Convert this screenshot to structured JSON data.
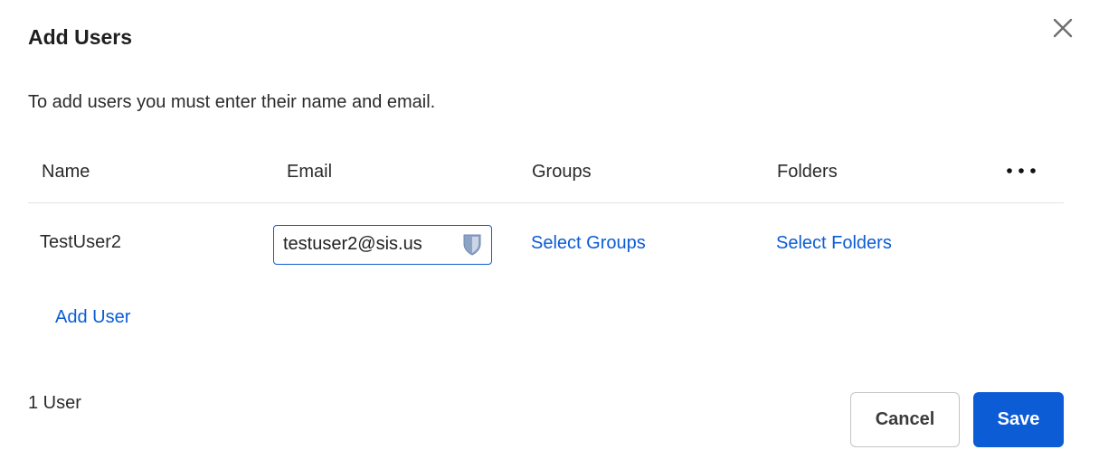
{
  "dialog": {
    "title": "Add Users",
    "close_icon": "close-icon",
    "subtitle": "To add users you must enter their name and email."
  },
  "table": {
    "columns": [
      "Name",
      "Email",
      "Groups",
      "Folders"
    ],
    "more_icon": "more-horizontal-icon",
    "rows": [
      {
        "name": "TestUser2",
        "email": "testuser2@sis.us",
        "groups_link": "Select Groups",
        "folders_link": "Select Folders",
        "email_field_icon": "password-manager-shield-icon"
      }
    ]
  },
  "add_user_link": "Add User",
  "footer": {
    "count": "1 User",
    "cancel_label": "Cancel",
    "save_label": "Save"
  },
  "colors": {
    "accent": "#0b5cd5",
    "text": "#222222",
    "border": "#c4c4c4",
    "divider": "#e4e4e4"
  }
}
